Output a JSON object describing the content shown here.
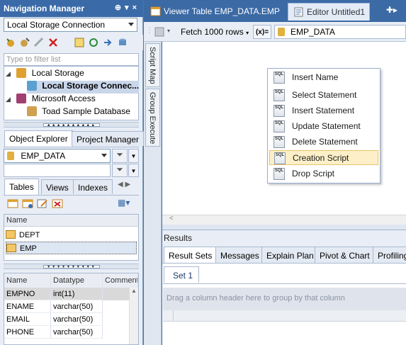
{
  "nav": {
    "title": "Navigation Manager",
    "connection_select": "Local Storage Connection",
    "filter_placeholder": "Type to filter list",
    "tree": [
      {
        "label": "Local Storage",
        "icon": "database-storage-icon"
      },
      {
        "label": "Local Storage Connec...",
        "icon": "connection-icon",
        "selected": true
      },
      {
        "label": "Microsoft Access",
        "icon": "access-key-icon"
      },
      {
        "label": "Toad Sample Database",
        "icon": "database-link-icon"
      }
    ],
    "explorer_tabs": [
      "Object Explorer",
      "Project Manager"
    ],
    "schema_select": "EMP_DATA",
    "object_tabs": [
      "Tables",
      "Views",
      "Indexes"
    ],
    "tables_header": "Name",
    "tables": [
      "DEPT",
      "EMP"
    ],
    "columns_headers": [
      "Name",
      "Datatype",
      "Comment"
    ],
    "columns": [
      {
        "name": "EMPNO",
        "type": "int(11)"
      },
      {
        "name": "ENAME",
        "type": "varchar(50)"
      },
      {
        "name": "EMAIL",
        "type": "varchar(50)"
      },
      {
        "name": "PHONE",
        "type": "varchar(50)"
      }
    ]
  },
  "doc_tabs": [
    "Viewer Table EMP_DATA.EMP",
    "Editor Untitled1"
  ],
  "toolbar": {
    "fetch_label": "Fetch 1000 rows",
    "x_button": "(x)=",
    "schema": "EMP_DATA"
  },
  "side_tabs": [
    "Script Map",
    "Group Execute"
  ],
  "context_menu": {
    "items": [
      "Insert Name",
      "Select Statement",
      "Insert Statement",
      "Update Statement",
      "Delete Statement",
      "Creation Script",
      "Drop Script"
    ],
    "highlighted_index": 5,
    "icon_text": "SQL"
  },
  "results": {
    "title": "Results",
    "tabs": [
      "Result Sets",
      "Messages",
      "Explain Plan",
      "Pivot & Chart",
      "Profiling"
    ],
    "set_tab": "Set 1",
    "group_hint": "Drag a column header here to group by that column"
  },
  "colors": {
    "nav_title": "#3a6aa8",
    "highlight": "#fdf0c8",
    "selection": "#c9d6ea"
  }
}
